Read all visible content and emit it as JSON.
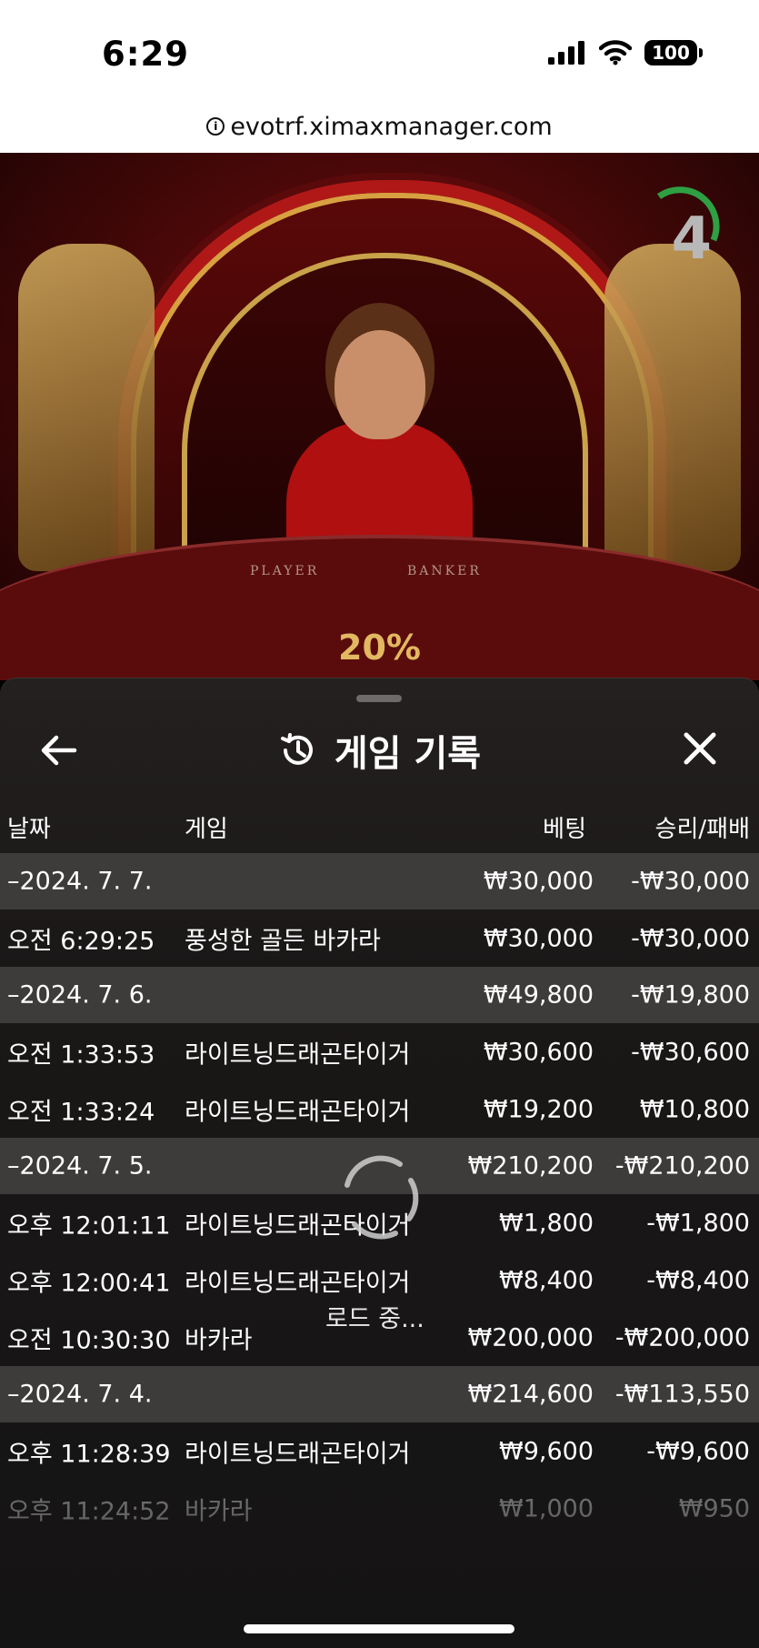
{
  "status": {
    "time": "6:29",
    "battery": "100"
  },
  "browser": {
    "url": "evotrf.ximaxmanager.com"
  },
  "video": {
    "countdown": "4",
    "multiplier": "20%",
    "table_left": "PLAYER",
    "table_right": "BANKER"
  },
  "panel": {
    "title": "게임 기록",
    "columns": {
      "date": "날짜",
      "game": "게임",
      "bet": "베팅",
      "winloss": "승리/패배"
    },
    "rows": [
      {
        "kind": "date",
        "time": "–2024. 7. 7.",
        "game": "",
        "bet": "₩30,000",
        "winloss": "-₩30,000"
      },
      {
        "kind": "item",
        "time": "오전 6:29:25",
        "game": "풍성한 골든 바카라",
        "bet": "₩30,000",
        "winloss": "-₩30,000"
      },
      {
        "kind": "date",
        "time": "–2024. 7. 6.",
        "game": "",
        "bet": "₩49,800",
        "winloss": "-₩19,800"
      },
      {
        "kind": "item",
        "time": "오전 1:33:53",
        "game": "라이트닝드래곤타이거",
        "bet": "₩30,600",
        "winloss": "-₩30,600"
      },
      {
        "kind": "item",
        "time": "오전 1:33:24",
        "game": "라이트닝드래곤타이거",
        "bet": "₩19,200",
        "winloss": "₩10,800"
      },
      {
        "kind": "date",
        "time": "–2024. 7. 5.",
        "game": "",
        "bet": "₩210,200",
        "winloss": "-₩210,200"
      },
      {
        "kind": "item",
        "time": "오후 12:01:11",
        "game": "라이트닝드래곤타이거",
        "bet": "₩1,800",
        "winloss": "-₩1,800"
      },
      {
        "kind": "item",
        "time": "오후 12:00:41",
        "game": "라이트닝드래곤타이거",
        "bet": "₩8,400",
        "winloss": "-₩8,400"
      },
      {
        "kind": "item",
        "time": "오전 10:30:30",
        "game": "바카라",
        "bet": "₩200,000",
        "winloss": "-₩200,000"
      },
      {
        "kind": "date",
        "time": "–2024. 7. 4.",
        "game": "",
        "bet": "₩214,600",
        "winloss": "-₩113,550"
      },
      {
        "kind": "item",
        "time": "오후 11:28:39",
        "game": "라이트닝드래곤타이거",
        "bet": "₩9,600",
        "winloss": "-₩9,600"
      },
      {
        "kind": "item",
        "time": "오후 11:24:52",
        "game": "바카라",
        "bet": "₩1,000",
        "winloss": "₩950"
      }
    ],
    "loading_text": "로드 중..."
  },
  "colors": {
    "panel_bg": "#1a1717",
    "date_row_bg": "#3e3b3b",
    "multiplier_gold": "#e2b860",
    "countdown_green": "#2ea043"
  },
  "icons": [
    "info-icon",
    "signal-icon",
    "wifi-icon",
    "battery-icon",
    "back-arrow-icon",
    "history-icon",
    "close-icon",
    "loading-spinner-icon"
  ]
}
